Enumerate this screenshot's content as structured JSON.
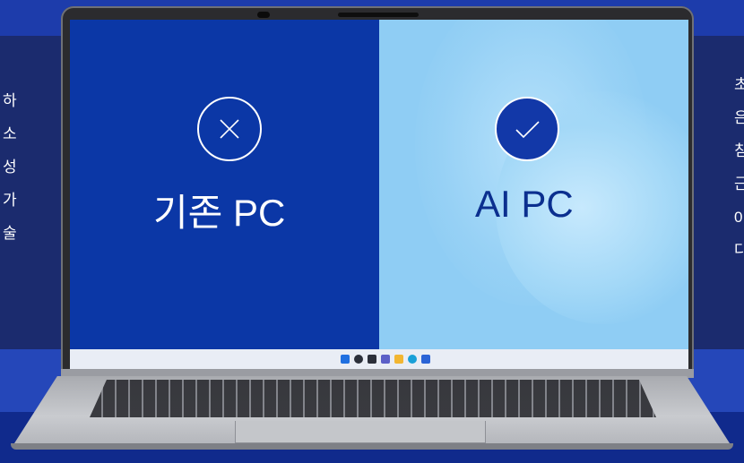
{
  "side_left": {
    "lines": [
      "하",
      "소",
      "성",
      "가",
      "술"
    ]
  },
  "side_right": {
    "lines": [
      "초",
      "은",
      "침",
      "근",
      "0",
      "다"
    ]
  },
  "screen": {
    "left_label": "기존 PC",
    "right_label": "AI PC",
    "left_icon": "x-circle-icon",
    "right_icon": "check-circle-icon"
  },
  "taskbar": {
    "icons": [
      "windows-start-icon",
      "search-icon",
      "task-view-icon",
      "chat-icon",
      "file-explorer-icon",
      "edge-browser-icon",
      "store-icon"
    ]
  },
  "colors": {
    "left_pane": "#0b37a6",
    "right_pane": "#8fcdf4",
    "page_band": "#1b2b6e",
    "accent": "#1238a8"
  }
}
